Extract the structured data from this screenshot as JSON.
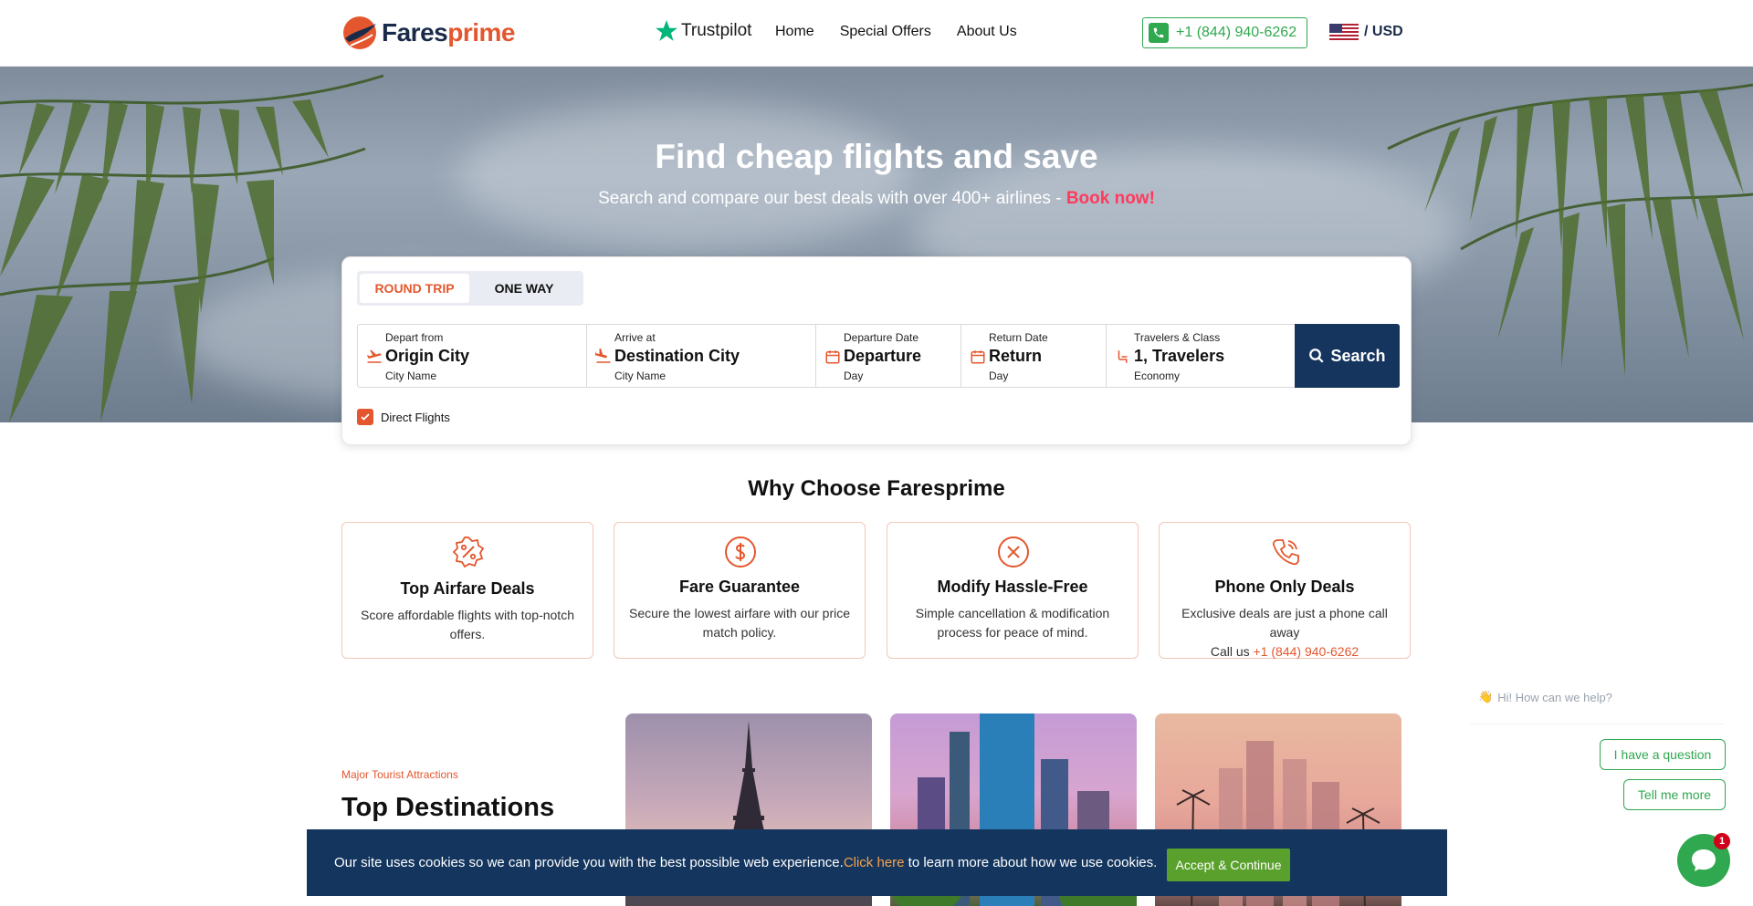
{
  "header": {
    "logo_part1": "Fares",
    "logo_part2": "prime",
    "trustpilot": "Trustpilot",
    "nav": [
      "Home",
      "Special Offers",
      "About Us"
    ],
    "phone": "+1 (844) 940-6262",
    "currency": "/ USD"
  },
  "hero": {
    "title": "Find cheap flights and save",
    "subtitle": "Search and compare our best deals with over 400+ airlines - ",
    "cta": "Book now!"
  },
  "search": {
    "tabs": {
      "round_trip": "ROUND TRIP",
      "one_way": "ONE WAY"
    },
    "fields": {
      "depart": {
        "label": "Depart from",
        "value": "Origin City",
        "hint": "City Name"
      },
      "arrive": {
        "label": "Arrive at",
        "value": "Destination City",
        "hint": "City Name"
      },
      "departure_date": {
        "label": "Departure Date",
        "value": "Departure",
        "hint": "Day"
      },
      "return_date": {
        "label": "Return Date",
        "value": "Return",
        "hint": "Day"
      },
      "travelers": {
        "label": "Travelers & Class",
        "value": "1, Travelers",
        "hint": "Economy"
      }
    },
    "search_label": "Search",
    "direct_flights": "Direct Flights",
    "direct_checked": true
  },
  "why": {
    "title": "Why Choose Faresprime",
    "features": [
      {
        "icon": "discount-badge-icon",
        "title": "Top Airfare Deals",
        "desc": "Score affordable flights with top-notch offers."
      },
      {
        "icon": "dollar-circle-icon",
        "title": "Fare Guarantee",
        "desc": "Secure the lowest airfare with our price match policy."
      },
      {
        "icon": "cancel-circle-icon",
        "title": "Modify Hassle-Free",
        "desc": "Simple cancellation & modification process for peace of mind."
      },
      {
        "icon": "phone-call-icon",
        "title": "Phone Only Deals",
        "desc": "Exclusive deals are just a phone call away",
        "call_prefix": "Call us ",
        "call_number": "+1 (844) 940-6262"
      }
    ]
  },
  "destinations": {
    "kicker": "Major Tourist Attractions",
    "title": "Top Destinations Around the World"
  },
  "cookie": {
    "text_before": "Our site uses cookies so we can provide you with the best possible web experience. ",
    "link": "Click here",
    "text_after": " to learn more about how we use cookies.",
    "accept": "Accept & Continue"
  },
  "chat": {
    "greeting": "Hi! How can we help?",
    "options": [
      "I have a question",
      "Tell me more"
    ],
    "badge": "1"
  },
  "colors": {
    "brand_orange": "#e4572e",
    "brand_navy": "#16355e",
    "green": "#2fa84f",
    "book_now": "#ff3a5c"
  }
}
